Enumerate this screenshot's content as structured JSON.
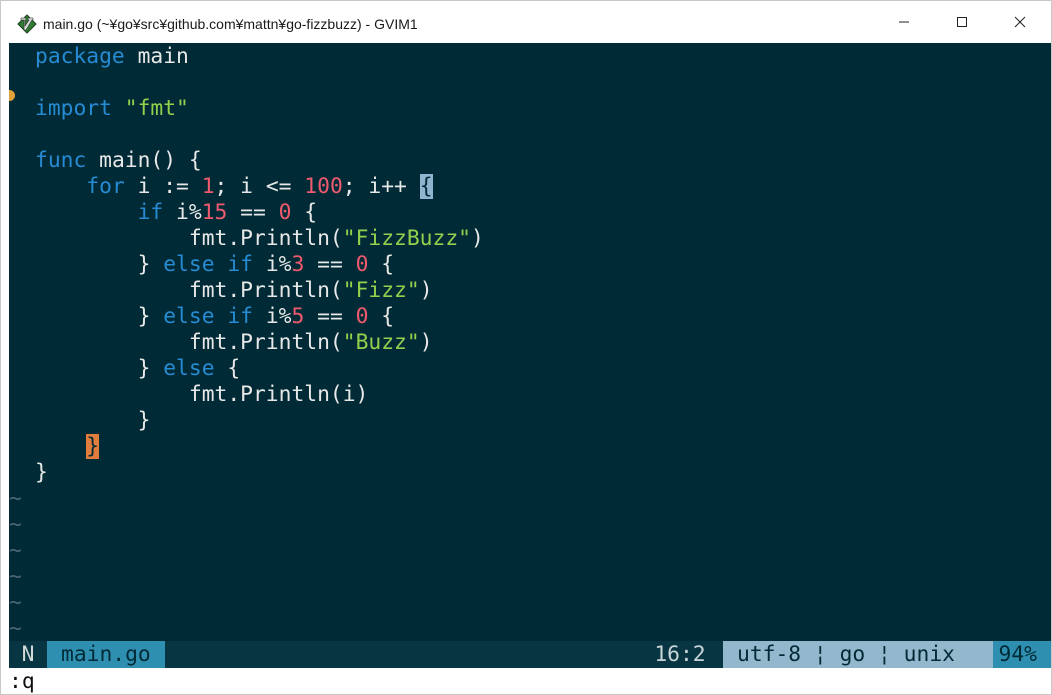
{
  "window": {
    "title": "main.go (~¥go¥src¥github.com¥mattn¥go-fizzbuzz) - GVIM1"
  },
  "code": {
    "line1": {
      "kw": "package",
      "rest": " main"
    },
    "line3": {
      "kw": "import",
      "sp": " ",
      "str": "\"fmt\""
    },
    "line5": {
      "kw": "func",
      "rest": " main() {"
    },
    "line6": {
      "indent": "    ",
      "kw": "for",
      "a": " i := ",
      "n1": "1",
      "b": "; i <= ",
      "n2": "100",
      "c": "; i++ ",
      "cursor": "{"
    },
    "line7": {
      "indent": "        ",
      "kw": "if",
      "a": " i%",
      "n1": "15",
      "b": " == ",
      "n2": "0",
      "c": " {"
    },
    "line8": {
      "indent": "            ",
      "a": "fmt.Println(",
      "str": "\"FizzBuzz\"",
      "b": ")"
    },
    "line9": {
      "indent": "        ",
      "a": "} ",
      "kw": "else if",
      "b": " i%",
      "n1": "3",
      "c": " == ",
      "n2": "0",
      "d": " {"
    },
    "line10": {
      "indent": "            ",
      "a": "fmt.Println(",
      "str": "\"Fizz\"",
      "b": ")"
    },
    "line11": {
      "indent": "        ",
      "a": "} ",
      "kw": "else if",
      "b": " i%",
      "n1": "5",
      "c": " == ",
      "n2": "0",
      "d": " {"
    },
    "line12": {
      "indent": "            ",
      "a": "fmt.Println(",
      "str": "\"Buzz\"",
      "b": ")"
    },
    "line13": {
      "indent": "        ",
      "a": "} ",
      "kw": "else",
      "b": " {"
    },
    "line14": {
      "indent": "            ",
      "a": "fmt.Println(i)"
    },
    "line15": {
      "indent": "        ",
      "a": "}"
    },
    "line16": {
      "indent": "    ",
      "match": "}"
    },
    "line17": {
      "a": "}"
    },
    "tilde": "~"
  },
  "statusline": {
    "mode": "N",
    "filename": "main.go",
    "position": "16:2",
    "encoding_info": "utf-8 ¦ go ¦ unix",
    "percent": "94%"
  },
  "cmdline": {
    "text": ":q"
  },
  "colors": {
    "editor_bg": "#002b36",
    "keyword": "#268bd2",
    "string": "#93d14d",
    "number": "#ef5a6f",
    "cursor_bg": "#8fb4d0",
    "match_paren_bg": "#e07c3c"
  },
  "icons": {
    "app": "vim-logo-icon",
    "minimize": "minimize-icon",
    "maximize": "maximize-icon",
    "close": "close-icon"
  }
}
